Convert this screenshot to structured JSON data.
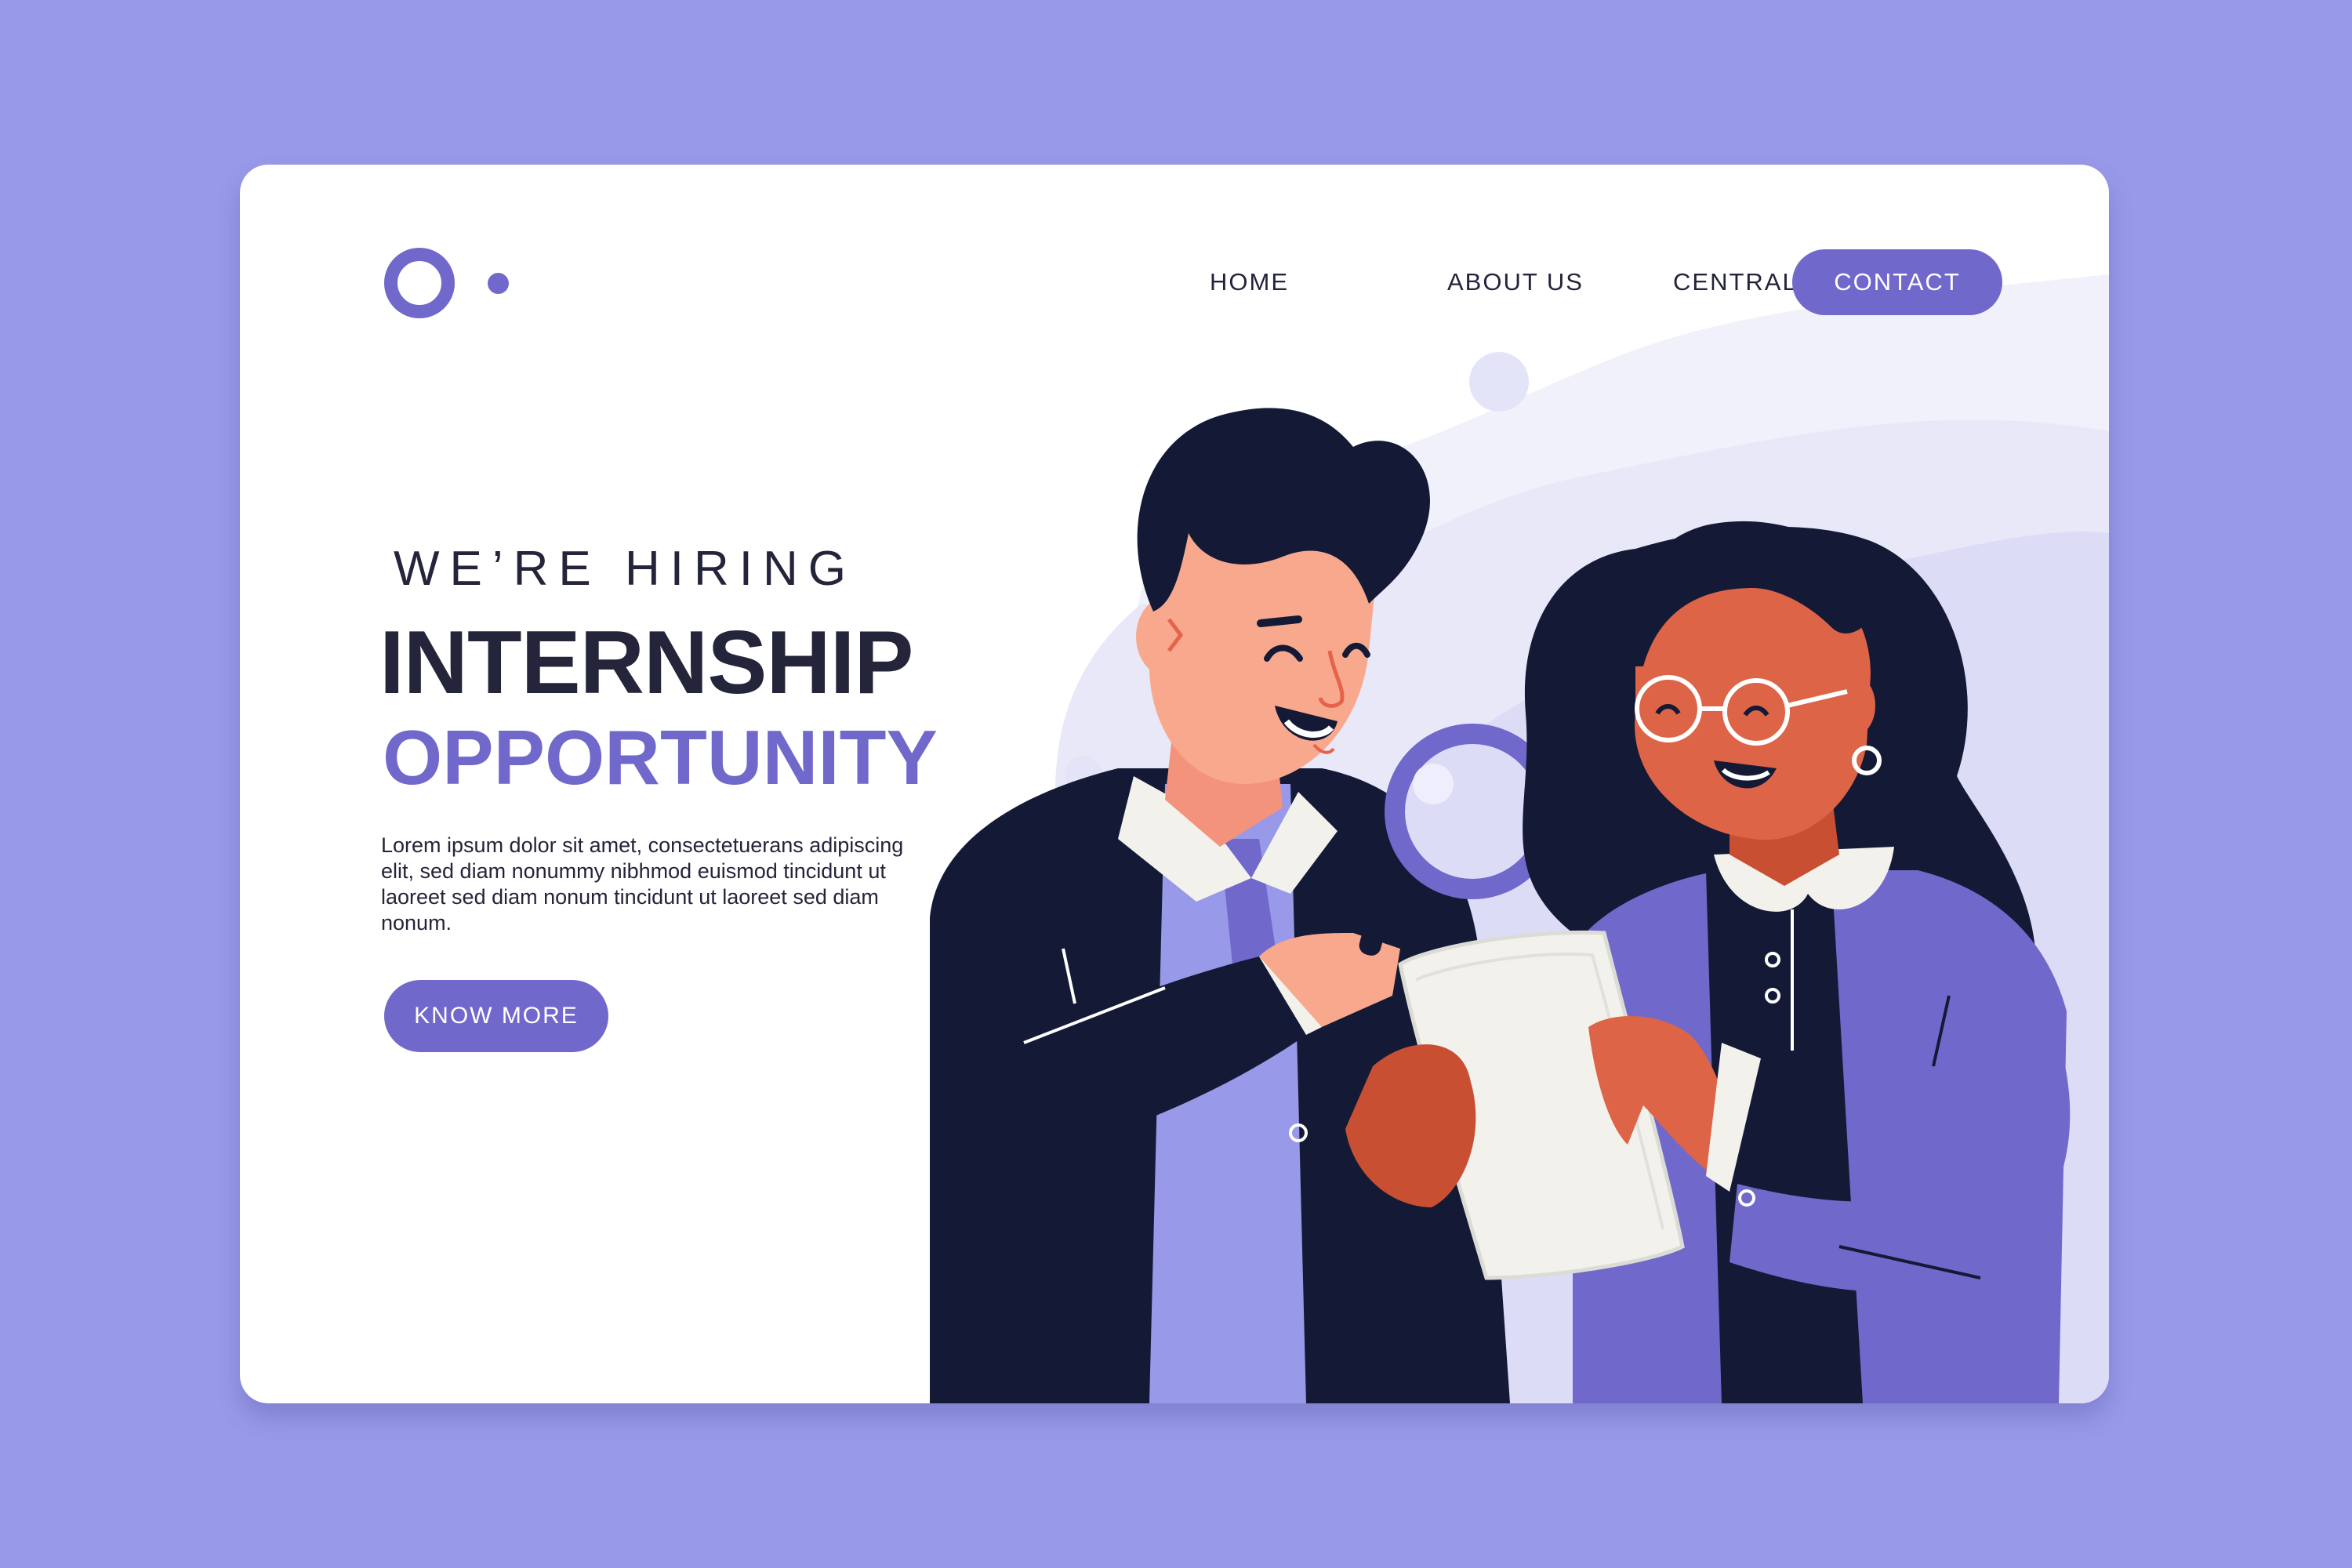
{
  "nav": {
    "home": "HOME",
    "about": "ABOUT US",
    "central": "CENTRAL",
    "contact": "CONTACT"
  },
  "hero": {
    "subtitle": "WE’RE HIRING",
    "title": "INTERNSHIP",
    "highlight": "OPPORTUNITY",
    "body": "Lorem ipsum dolor sit amet, consectetuerans adipiscing elit, sed diam nonummy nibhmod euismod tincidunt ut laoreet sed diam nonum tincidunt ut laoreet sed diam nonum.",
    "cta": "KNOW MORE"
  },
  "icons": {
    "logo": "circle-dot-logo-icon",
    "illustration": "two-people-magnifier-document"
  },
  "colors": {
    "page_background": "#9899e8",
    "accent": "#7168cb",
    "text_dark": "#24243a",
    "card": "#ffffff",
    "light_lavender": "#dcdcf7",
    "navy": "#141a36"
  }
}
